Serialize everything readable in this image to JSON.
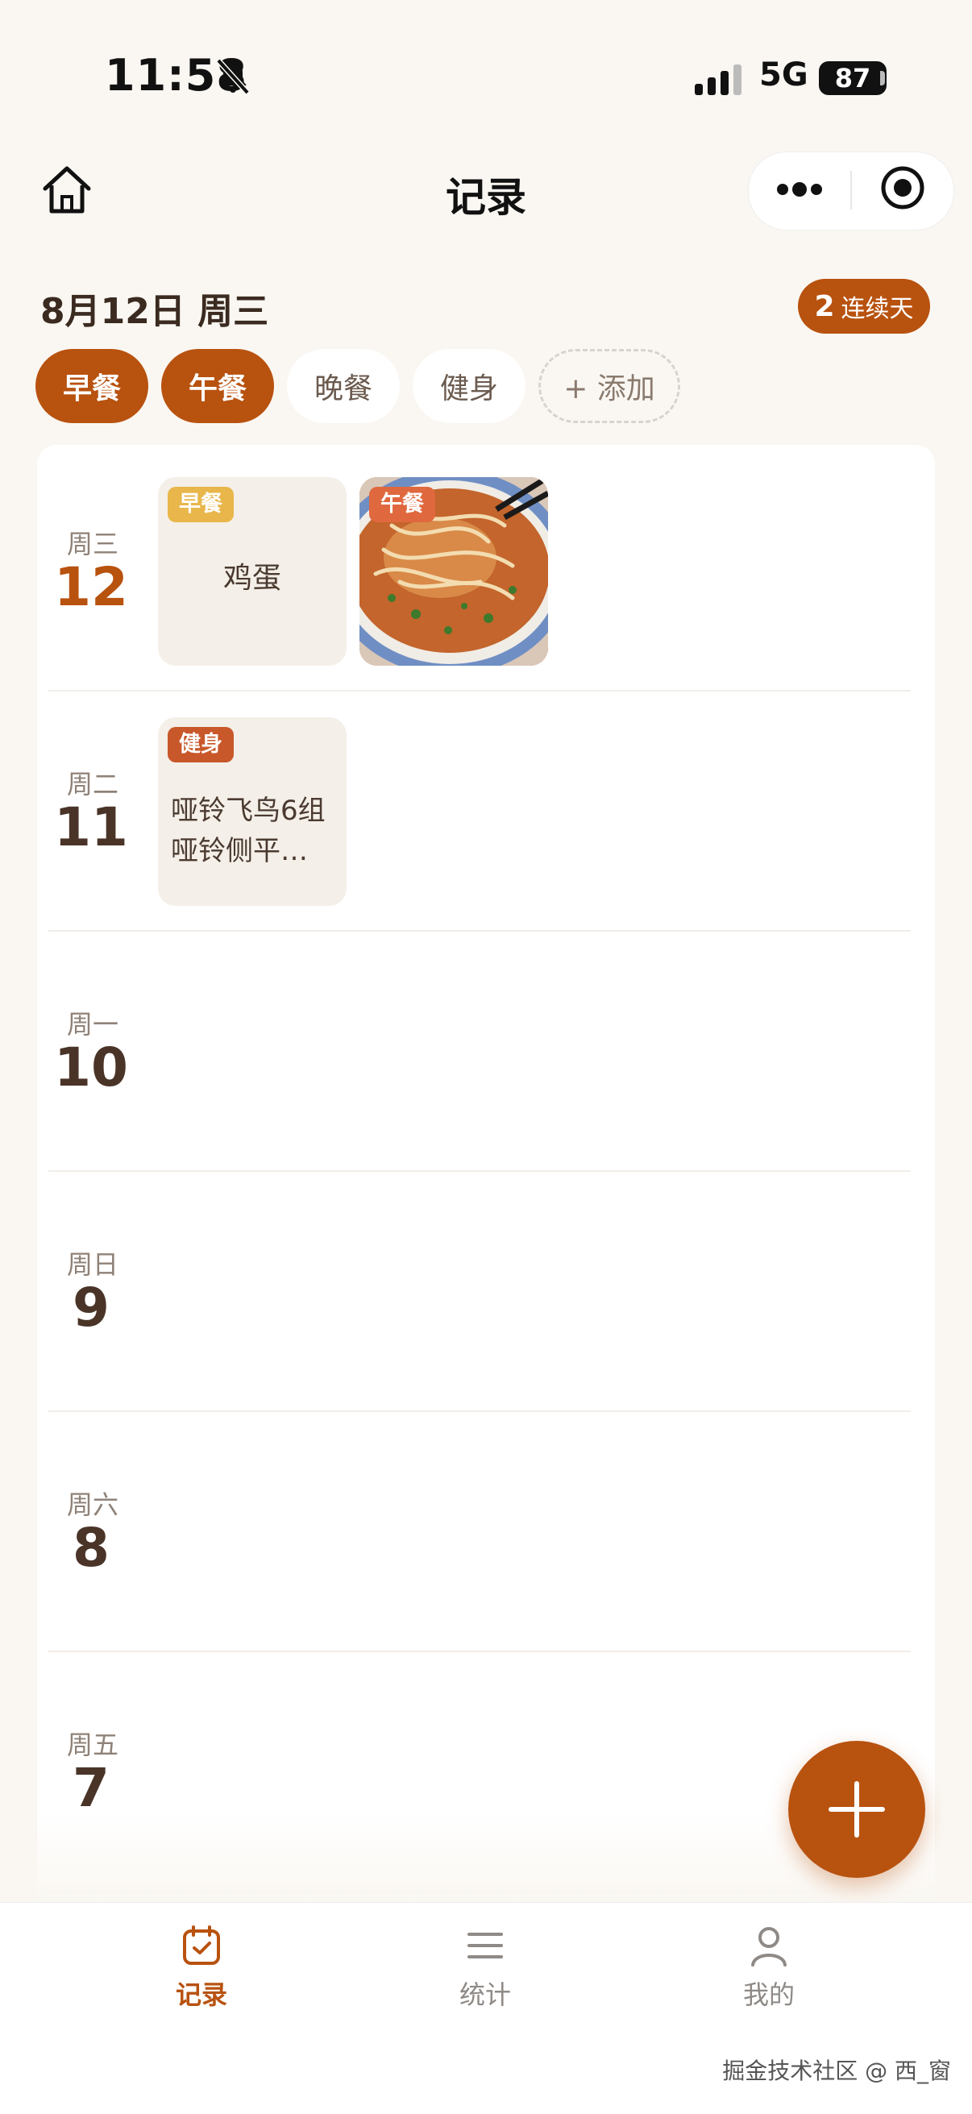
{
  "status_bar": {
    "time": "11:58",
    "network": "5G",
    "battery": "87"
  },
  "nav": {
    "title": "记录"
  },
  "header": {
    "date": "8月12日 周三",
    "streak_count": "2",
    "streak_label": "连续天"
  },
  "chips": [
    {
      "label": "早餐",
      "active": true
    },
    {
      "label": "午餐",
      "active": true
    },
    {
      "label": "晚餐",
      "active": false
    },
    {
      "label": "健身",
      "active": false
    },
    {
      "label": "+ 添加",
      "add": true
    }
  ],
  "days": [
    {
      "weekday": "周三",
      "day": "12",
      "today": true,
      "entries": [
        {
          "tag": "早餐",
          "tag_color": "#e8b64a",
          "text": "鸡蛋"
        },
        {
          "tag": "午餐",
          "tag_color": "#e0683e",
          "image": "noodle-soup-photo"
        }
      ]
    },
    {
      "weekday": "周二",
      "day": "11",
      "entries": [
        {
          "tag": "健身",
          "tag_color": "#c8572a",
          "line1": "哑铃飞鸟6组",
          "line2": "哑铃侧平…"
        }
      ]
    },
    {
      "weekday": "周一",
      "day": "10",
      "entries": []
    },
    {
      "weekday": "周日",
      "day": "9",
      "entries": []
    },
    {
      "weekday": "周六",
      "day": "8",
      "entries": []
    },
    {
      "weekday": "周五",
      "day": "7",
      "entries": []
    }
  ],
  "tabbar": {
    "items": [
      {
        "label": "记录",
        "icon": "calendar-check-icon",
        "active": true
      },
      {
        "label": "统计",
        "icon": "list-lines-icon",
        "active": false
      },
      {
        "label": "我的",
        "icon": "person-icon",
        "active": false
      }
    ]
  },
  "colors": {
    "accent": "#b8520f",
    "background": "#faf7f2"
  },
  "watermark": "掘金技术社区 @ 西_窗"
}
